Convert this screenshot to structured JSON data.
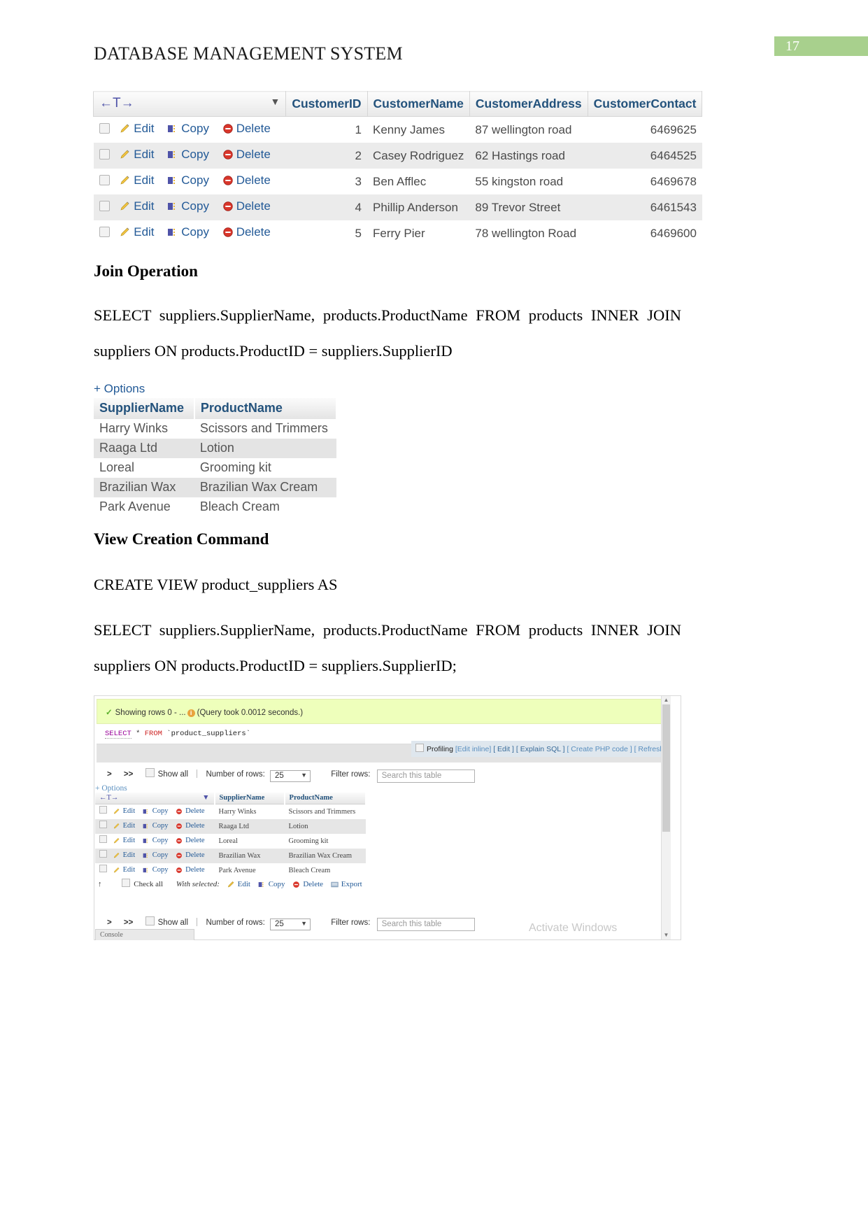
{
  "header": {
    "doc_title": "DATABASE MANAGEMENT SYSTEM",
    "page_number": "17"
  },
  "customers_result": {
    "nav_arrows": "←T→",
    "sort_caret": "▼",
    "columns": [
      "CustomerID",
      "CustomerName",
      "CustomerAddress",
      "CustomerContact"
    ],
    "actions": {
      "edit": "Edit",
      "copy": "Copy",
      "delete": "Delete"
    },
    "rows": [
      {
        "id": "1",
        "name": "Kenny James",
        "address": "87 wellington road",
        "contact": "6469625"
      },
      {
        "id": "2",
        "name": "Casey Rodriguez",
        "address": "62 Hastings road",
        "contact": "6464525"
      },
      {
        "id": "3",
        "name": "Ben Afflec",
        "address": "55 kingston road",
        "contact": "6469678"
      },
      {
        "id": "4",
        "name": "Phillip Anderson",
        "address": "89 Trevor Street",
        "contact": "6461543"
      },
      {
        "id": "5",
        "name": "Ferry Pier",
        "address": "78 wellington Road",
        "contact": "6469600"
      }
    ]
  },
  "join_section": {
    "heading": "Join Operation",
    "query": "SELECT  suppliers.SupplierName,  products.ProductName  FROM  products  INNER  JOIN suppliers ON products.ProductID = suppliers.SupplierID"
  },
  "join_result": {
    "options_label": "+ Options",
    "columns": [
      "SupplierName",
      "ProductName"
    ],
    "rows": [
      {
        "supplier": "Harry Winks",
        "product": "Scissors and Trimmers"
      },
      {
        "supplier": "Raaga Ltd",
        "product": "Lotion"
      },
      {
        "supplier": "Loreal",
        "product": "Grooming kit"
      },
      {
        "supplier": "Brazilian Wax",
        "product": "Brazilian Wax Cream"
      },
      {
        "supplier": "Park Avenue",
        "product": "Bleach Cream"
      }
    ]
  },
  "view_section": {
    "heading": "View Creation Command",
    "line1": "CREATE VIEW product_suppliers AS",
    "line2": "SELECT  suppliers.SupplierName,  products.ProductName  FROM  products  INNER  JOIN suppliers ON products.ProductID = suppliers.SupplierID;"
  },
  "browser_shot": {
    "status": {
      "showing_rows": "Showing rows 0 - ...",
      "query_time": "(Query took 0.0012 seconds.)"
    },
    "sql": {
      "select": "SELECT",
      "star": "*",
      "from": "FROM",
      "table": "`product_suppliers`"
    },
    "toolbar": {
      "profiling": "Profiling",
      "edit_inline": "[Edit inline]",
      "edit": "[ Edit ]",
      "explain_sql": "[ Explain SQL ]",
      "create_php": "[ Create PHP code ]",
      "refresh": "[ Refresh ]"
    },
    "rows_controls": {
      "next": ">",
      "last": ">>",
      "show_all": "Show all",
      "number_of_rows_label": "Number of rows:",
      "number_of_rows_value": "25",
      "caret": "▼",
      "filter_label": "Filter rows:",
      "filter_placeholder": "Search this table"
    },
    "options_label": "+ Options",
    "grid": {
      "nav_arrows": "←T→",
      "sort_caret": "▼",
      "columns": [
        "SupplierName",
        "ProductName"
      ],
      "actions": {
        "edit": "Edit",
        "copy": "Copy",
        "delete": "Delete"
      },
      "rows": [
        {
          "supplier": "Harry Winks",
          "product": "Scissors and Trimmers"
        },
        {
          "supplier": "Raaga Ltd",
          "product": "Lotion"
        },
        {
          "supplier": "Loreal",
          "product": "Grooming kit"
        },
        {
          "supplier": "Brazilian Wax",
          "product": "Brazilian Wax Cream"
        },
        {
          "supplier": "Park Avenue",
          "product": "Bleach Cream"
        }
      ]
    },
    "footer_actions": {
      "up_arrow": "↑",
      "check_all": "Check all",
      "with_selected": "With selected:",
      "edit": "Edit",
      "copy": "Copy",
      "delete": "Delete",
      "export": "Export"
    },
    "watermark": "Activate Windows",
    "console_tab": "Console"
  },
  "colors": {
    "page_badge": "#a8d08d",
    "status_bar": "#eeffbb",
    "link": "#235a97",
    "header_text": "#23527c",
    "nav_arrow": "#4f53a8"
  }
}
